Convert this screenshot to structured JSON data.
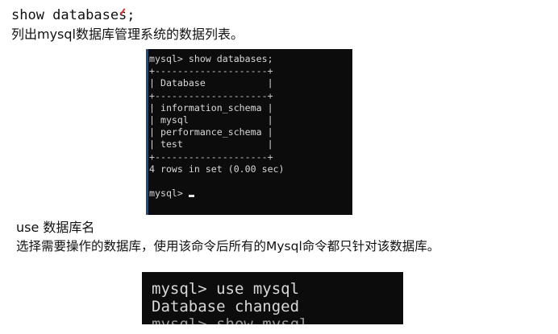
{
  "section1": {
    "command": "show databases;",
    "description": "列出mysql数据库管理系统的数据列表。"
  },
  "terminal1": {
    "lines": [
      "mysql> show databases;",
      "+--------------------+",
      "| Database           |",
      "+--------------------+",
      "| information_schema |",
      "| mysql              |",
      "| performance_schema |",
      "| test               |",
      "+--------------------+",
      "4 rows in set (0.00 sec)",
      "",
      "mysql> "
    ]
  },
  "section2": {
    "command": "use 数据库名",
    "description": "选择需要操作的数据库，使用该命令后所有的Mysql命令都只针对该数据库。"
  },
  "terminal2": {
    "lines": [
      "mysql> use mysql",
      "Database changed",
      "mysql> show mysql"
    ]
  },
  "colors": {
    "terminal_bg": "#0c0c0c",
    "terminal_text": "#d8d8d8",
    "page_bg": "#ffffff",
    "annotation_mark": "#dd3333"
  }
}
